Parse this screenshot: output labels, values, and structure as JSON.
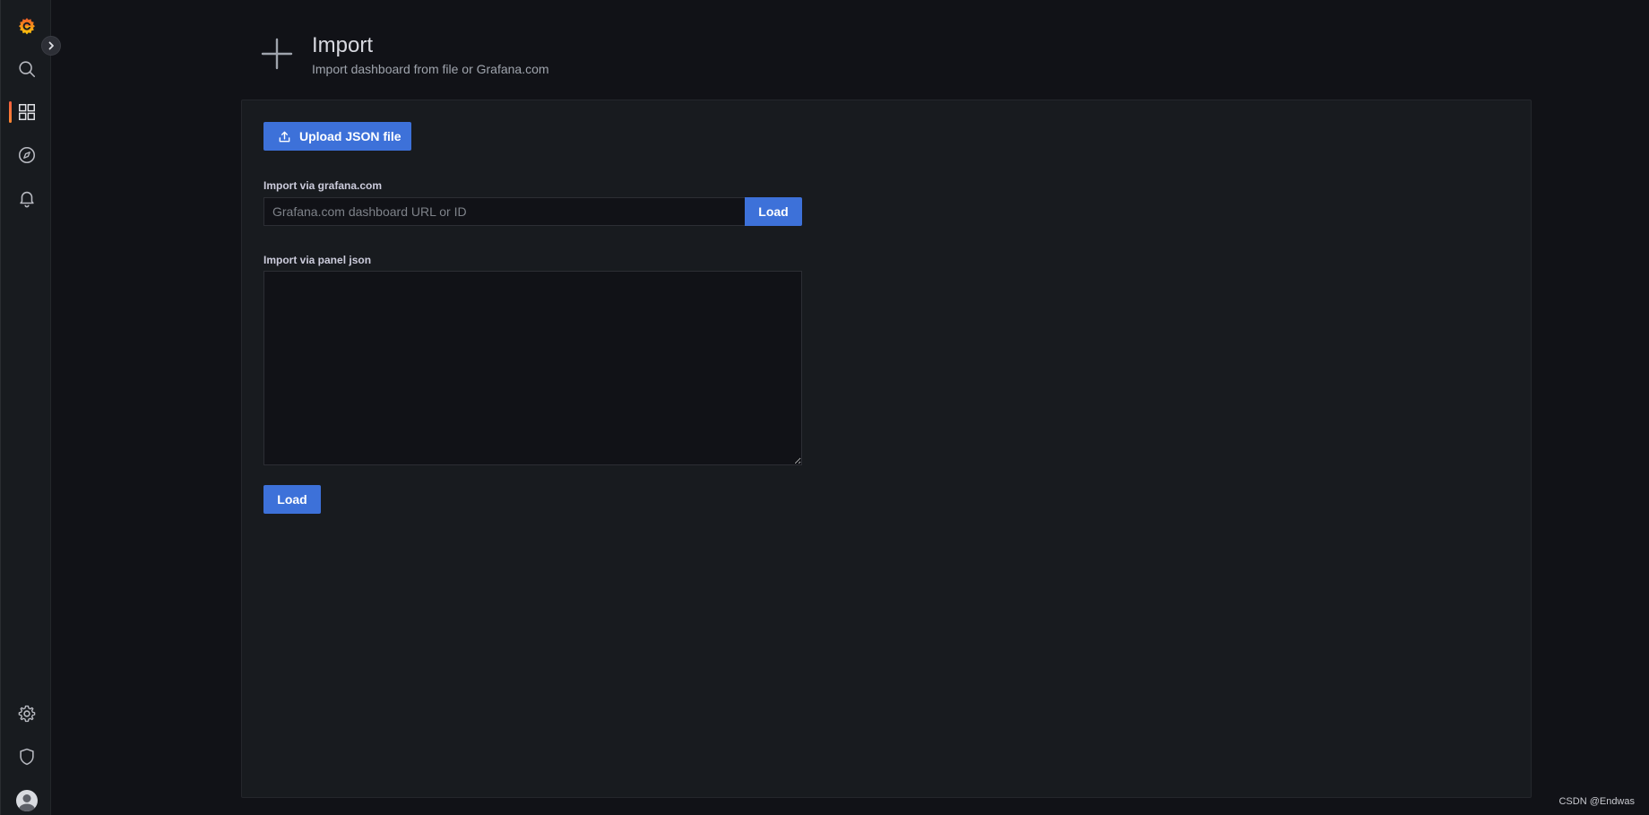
{
  "header": {
    "title": "Import",
    "subtitle": "Import dashboard from file or Grafana.com"
  },
  "sidebar": {
    "items": [
      {
        "name": "grafana-logo",
        "icon": "grafana-logo-icon"
      },
      {
        "name": "search",
        "icon": "search-icon"
      },
      {
        "name": "dashboards",
        "icon": "apps-grid-icon",
        "active": true
      },
      {
        "name": "explore",
        "icon": "compass-icon"
      },
      {
        "name": "alerting",
        "icon": "bell-icon"
      },
      {
        "name": "configuration",
        "icon": "gear-icon"
      },
      {
        "name": "server-admin",
        "icon": "shield-icon"
      },
      {
        "name": "profile",
        "icon": "avatar-icon"
      }
    ],
    "expand_icon": "chevron-right-icon"
  },
  "import": {
    "upload_label": "Upload JSON file",
    "grafana_label": "Import via grafana.com",
    "url_placeholder": "Grafana.com dashboard URL or ID",
    "url_value": "",
    "load_url_label": "Load",
    "json_label": "Import via panel json",
    "json_value": "",
    "load_json_label": "Load"
  },
  "watermark": "CSDN @Endwas",
  "colors": {
    "accent": "#3d71d9",
    "brand_orange": "#f55f3e",
    "background": "#111217",
    "panel": "#181b1f"
  }
}
